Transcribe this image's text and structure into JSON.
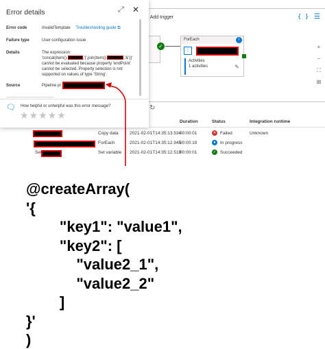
{
  "toolbar": {
    "add_trigger_label": "Add trigger",
    "code_icon": "{ }"
  },
  "canvas": {
    "foreach_title": "ForEach",
    "activities_label": "Activities",
    "activities_count": "1 activities"
  },
  "output": {
    "columns": [
      "Duration",
      "Status",
      "Integration runtime"
    ],
    "rows": [
      {
        "type": "Copy data",
        "start": "2021-02-01T14:35:13.534",
        "duration": "00:00:01",
        "status": "Failed",
        "runtime": "Unknown",
        "name_prefix": ""
      },
      {
        "type": "ForEach",
        "start": "2021-02-01T14:35:12.945",
        "duration": "00:00:19",
        "status": "In progress",
        "runtime": "",
        "name_prefix": ""
      },
      {
        "type": "Set variable",
        "start": "2021-02-01T14:35:12.519",
        "duration": "00:00:01",
        "status": "Succeeded",
        "runtime": "",
        "name_prefix": "Set"
      }
    ]
  },
  "error_panel": {
    "title": "Error details",
    "error_code_label": "Error code",
    "error_code_value": "InvalidTemplate",
    "troubleshooting_link": "Troubleshooting guide",
    "failure_type_label": "Failure type",
    "failure_type_value": "User configuration issue",
    "details_label": "Details",
    "details_line1": "The expression",
    "details_line2a": "'concat(item().",
    "details_line2b": ",'|',join(item().",
    "details_line2c": ",'&'))'",
    "details_line3": "cannot be evaluated because property 'endPoint' cannot be selected. Property selection is not supported on values of type 'String'.",
    "source_label": "Source",
    "source_value": "Pipeline pi",
    "feedback_question": "How helpful or unhelpful was this error message?",
    "stars": "★★★★★"
  },
  "code_snippet": [
    "@createArray(",
    "'{",
    "        \"key1\": \"value1\",",
    "        \"key2\": [",
    "            \"value2_1\",",
    "            \"value2_2\"",
    "        ]",
    "}'",
    ")"
  ],
  "colors": {
    "accent": "#0078d4",
    "failed": "#d13438",
    "succeeded": "#107c10",
    "redaction_border": "#dd0000"
  }
}
